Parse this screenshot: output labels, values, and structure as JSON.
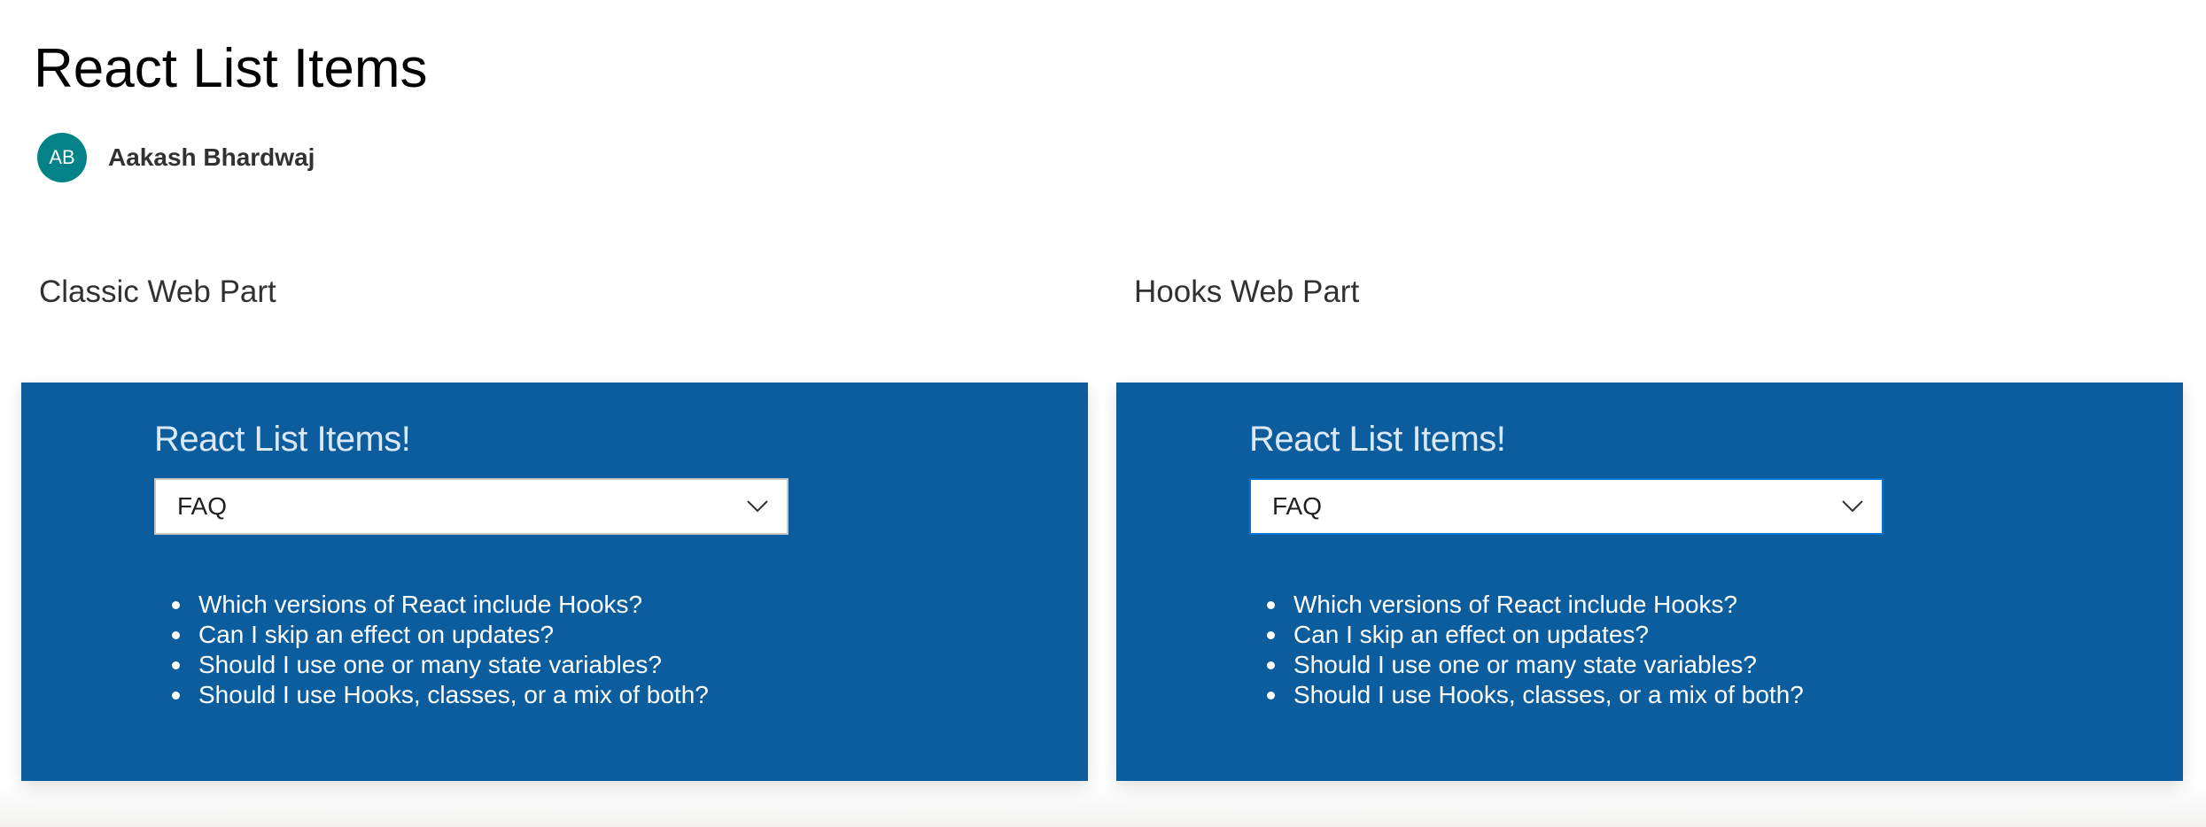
{
  "page": {
    "title": "React List Items"
  },
  "author": {
    "initials": "AB",
    "name": "Aakash Bhardwaj",
    "avatar_color": "#038387"
  },
  "colors": {
    "webpart_background": "#0c5d9e",
    "dropdown_focus_border": "#0078d4"
  },
  "webparts": [
    {
      "section_title": "Classic Web Part",
      "title": "React List Items!",
      "dropdown": {
        "selected": "FAQ",
        "icon": "chevron-down-icon"
      },
      "items": [
        "Which versions of React include Hooks?",
        "Can I skip an effect on updates?",
        "Should I use one or many state variables?",
        "Should I use Hooks, classes, or a mix of both?"
      ]
    },
    {
      "section_title": "Hooks Web Part",
      "title": "React List Items!",
      "dropdown": {
        "selected": "FAQ",
        "icon": "chevron-down-icon",
        "focused": true
      },
      "items": [
        "Which versions of React include Hooks?",
        "Can I skip an effect on updates?",
        "Should I use one or many state variables?",
        "Should I use Hooks, classes, or a mix of both?"
      ]
    }
  ]
}
